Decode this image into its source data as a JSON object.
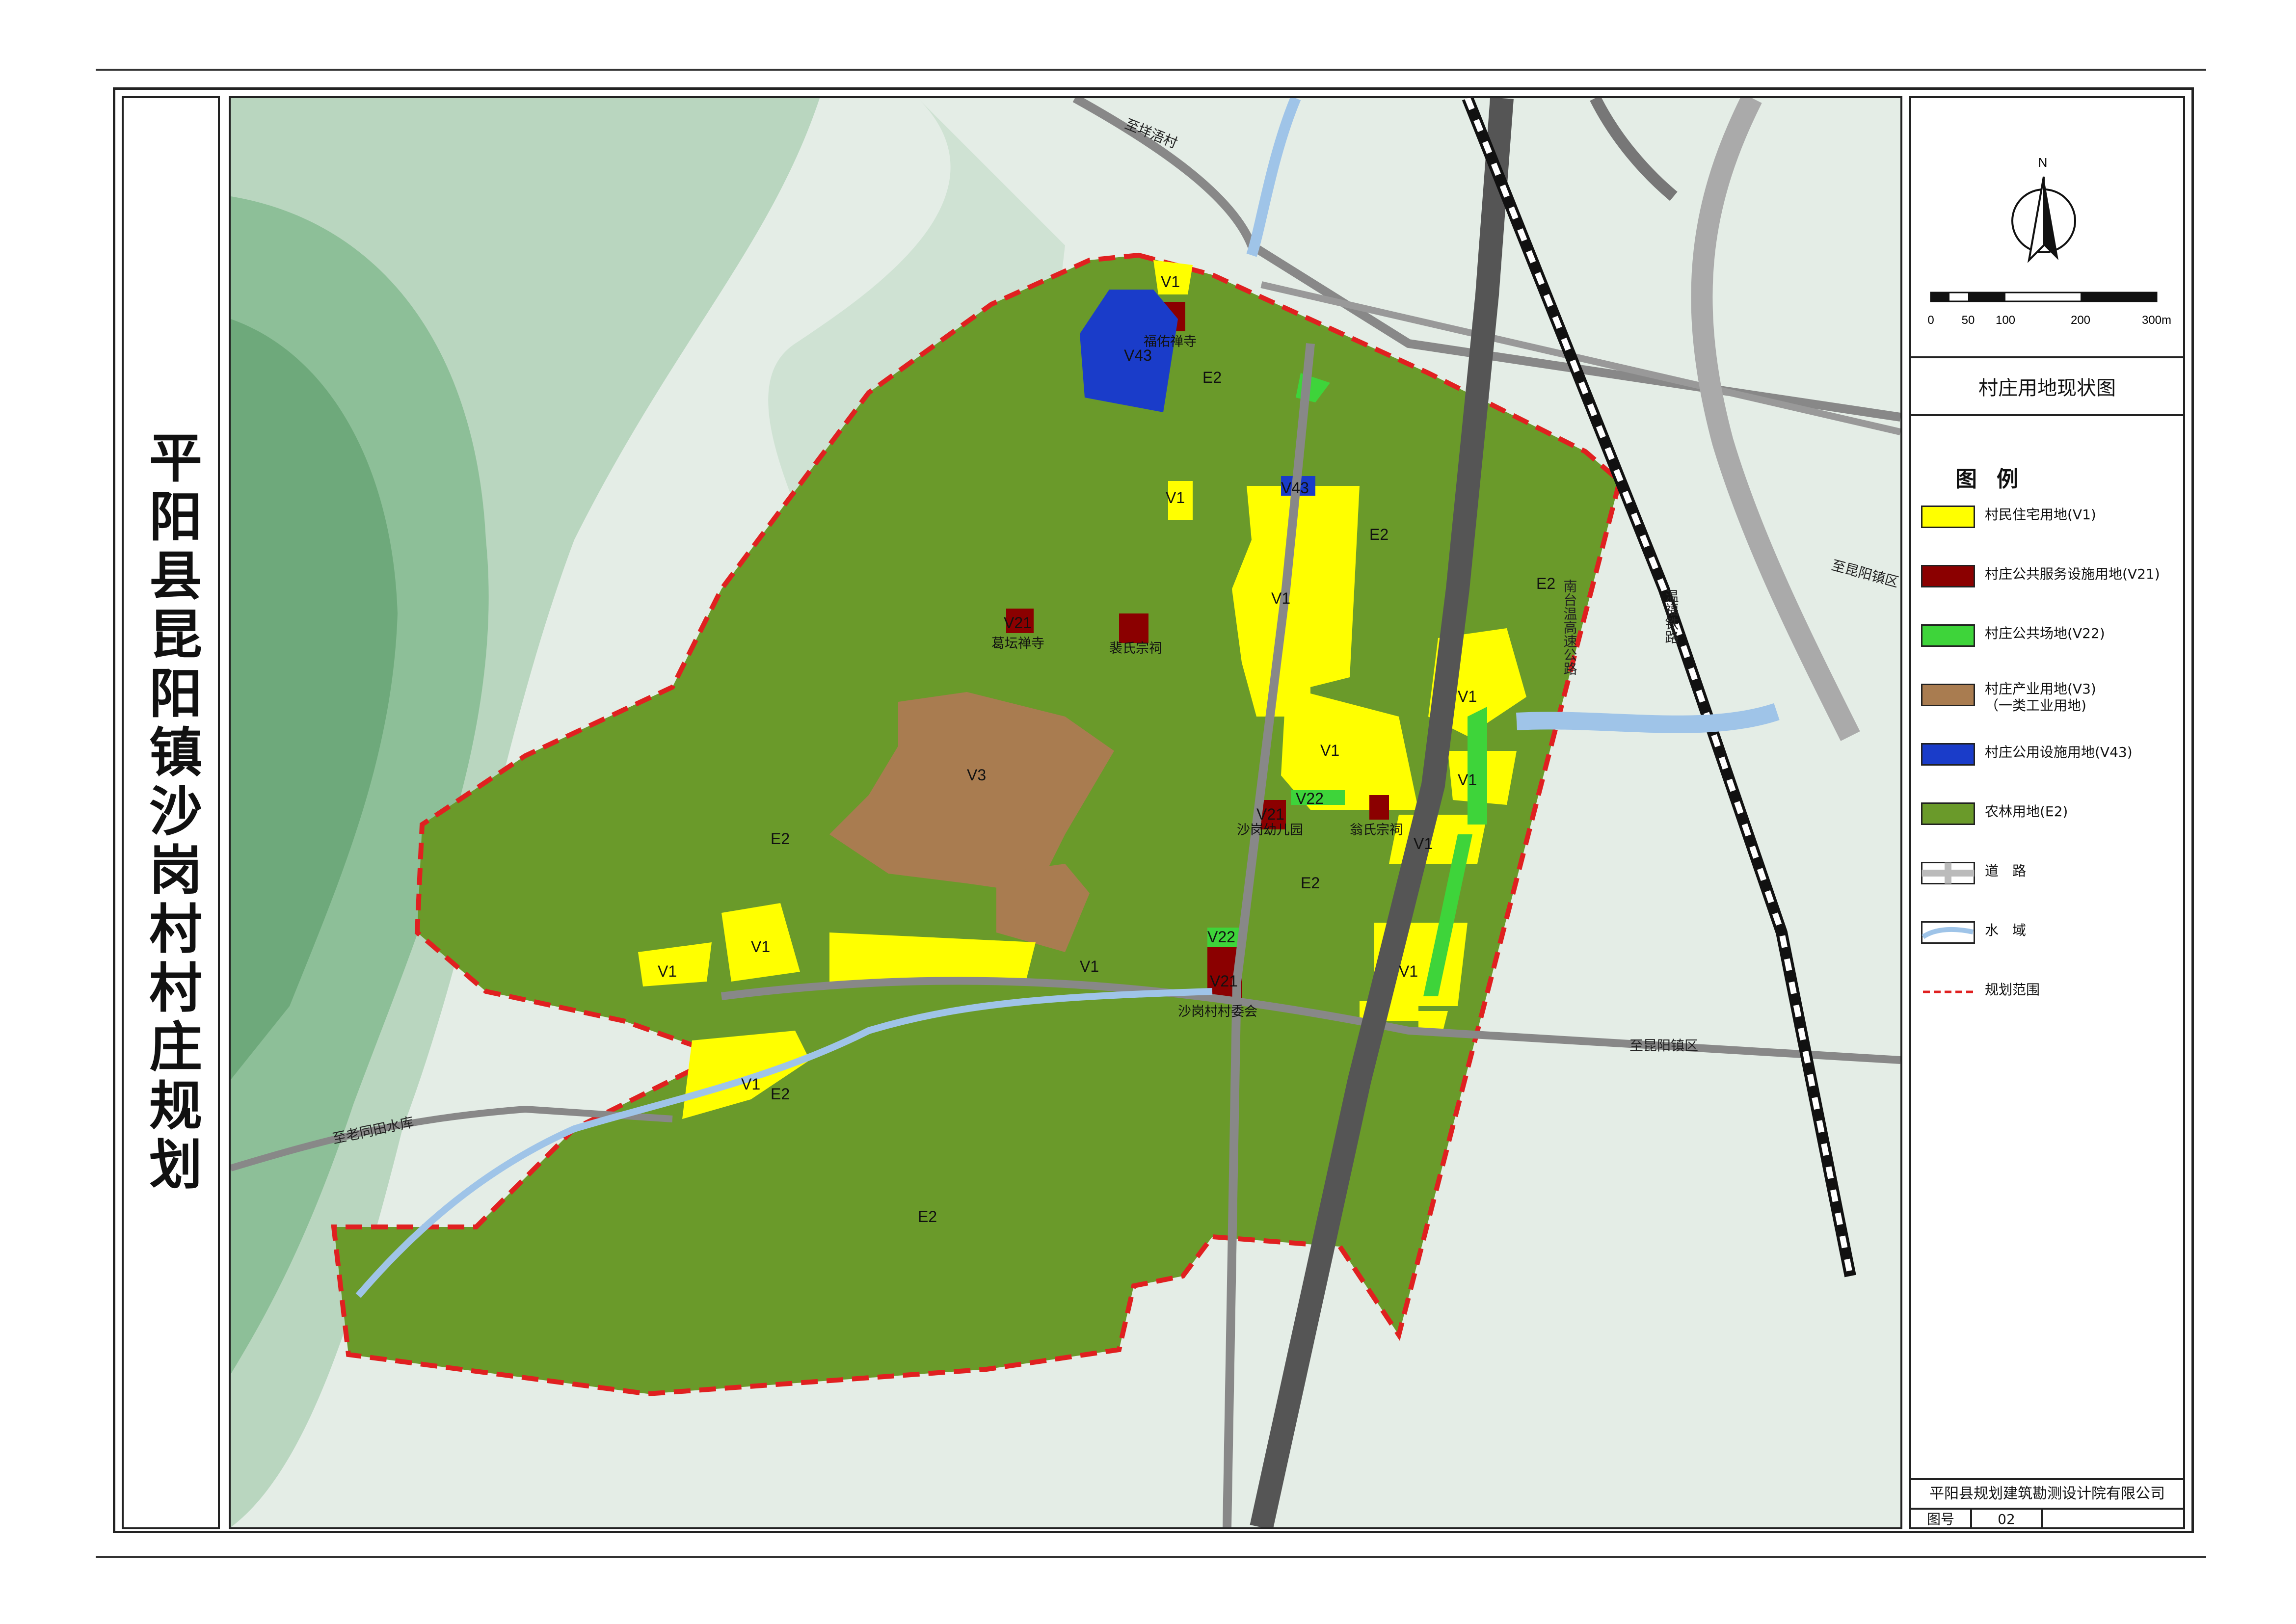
{
  "page_title": "平阳县昆阳镇沙岗村村庄规划",
  "sheet_title": "村庄用地现状图",
  "company": "平阳县规划建筑勘测设计院有限公司",
  "figure_number": {
    "label": "图号",
    "value": "02"
  },
  "north_label": "N",
  "scale_bar": {
    "ticks": [
      "0",
      "50",
      "100",
      "200",
      "300m"
    ]
  },
  "legend": {
    "title": "图例",
    "items": [
      {
        "label": "村民住宅用地(V1)",
        "color": "#ffff00",
        "icon": "swatch"
      },
      {
        "label": "村庄公共服务设施用地(V21)",
        "color": "#8b0000",
        "icon": "swatch"
      },
      {
        "label": "村庄公共场地(V22)",
        "color": "#3ed43a",
        "icon": "swatch"
      },
      {
        "label": "村庄产业用地(V3)\n（一类工业用地)",
        "color": "#a97c50",
        "icon": "swatch"
      },
      {
        "label": "村庄公用设施用地(V43)",
        "color": "#1a3cc9",
        "icon": "swatch"
      },
      {
        "label": "农林用地(E2)",
        "color": "#6a9a2a",
        "icon": "swatch"
      },
      {
        "label": "道　路",
        "icon": "road-icon"
      },
      {
        "label": "水　域",
        "icon": "water-icon"
      },
      {
        "label": "规划范围",
        "icon": "boundary-icon"
      }
    ]
  },
  "map": {
    "roads": {
      "to_pailuo": "至垟浯村",
      "to_kunyang_1": "至昆阳镇区",
      "to_kunyang_2": "至昆阳镇区",
      "to_laotongtian": "至老同田水库",
      "expressway": "南台温高速公路",
      "railway": "温福铁路"
    },
    "places": {
      "fuqing_temple": "福佑禅寺",
      "getan_temple": "葛坛禅寺",
      "pei_ancestral": "裴氏宗祠",
      "kindergarten": "沙岗幼儿园",
      "weng_ancestral": "翁氏宗祠",
      "village_committee": "沙岗村村委会"
    },
    "zones": {
      "V1": "V1",
      "V21": "V21",
      "V22": "V22",
      "V3": "V3",
      "V43": "V43",
      "E2": "E2"
    }
  }
}
